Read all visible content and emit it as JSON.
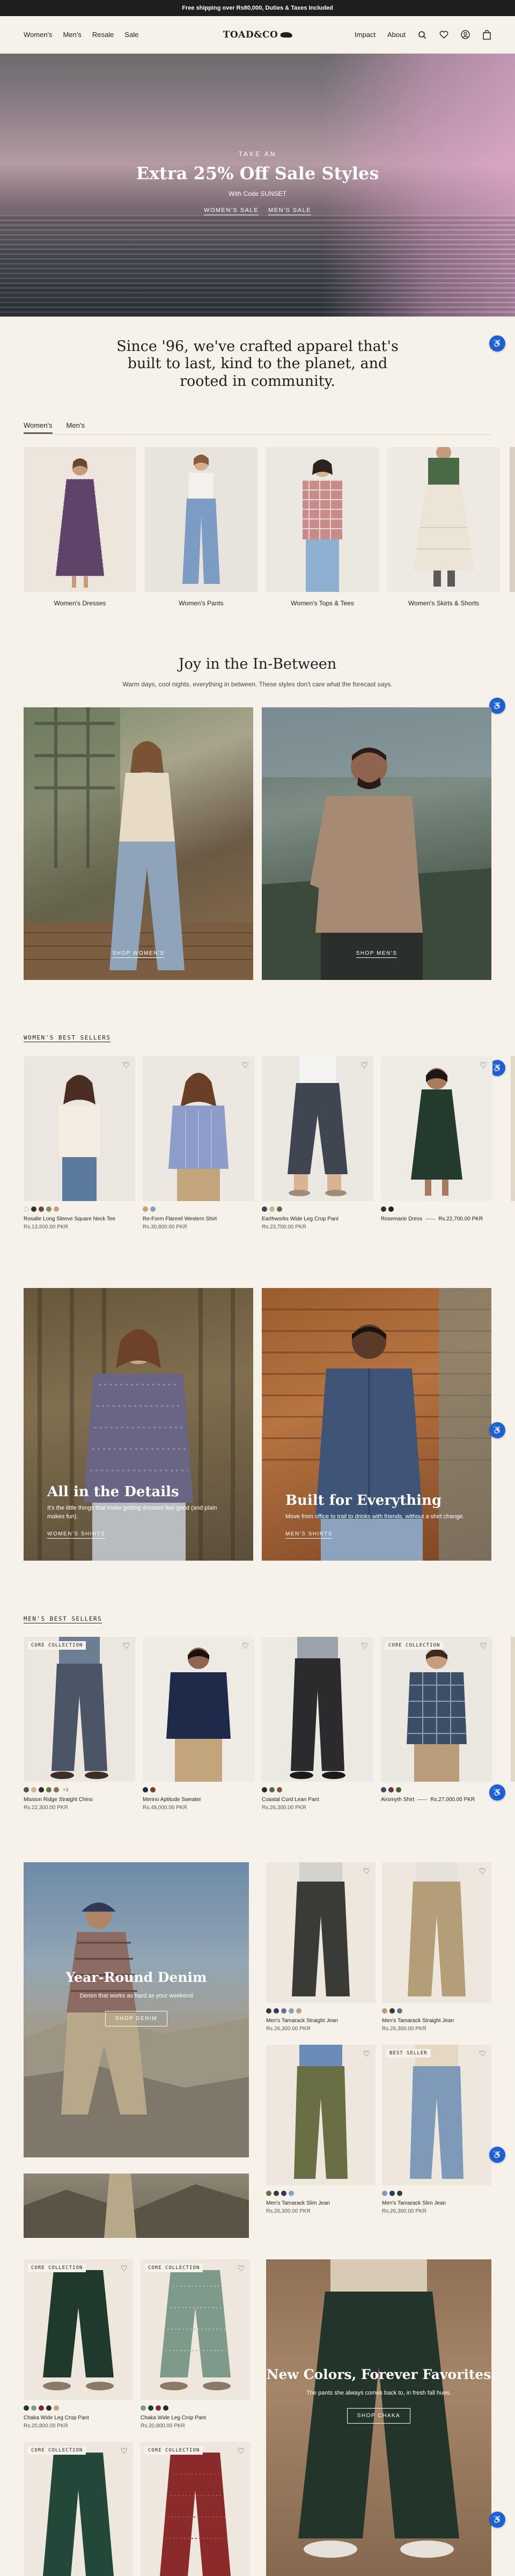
{
  "announcement": "Free shipping over Rs80,000, Duties & Taxes Included",
  "header": {
    "nav_left": [
      "Women's",
      "Men's",
      "Resale",
      "Sale"
    ],
    "logo": "TOAD&CO",
    "nav_right": [
      "Impact",
      "About"
    ],
    "icons": [
      "search-icon",
      "heart-icon",
      "account-icon",
      "bag-icon"
    ]
  },
  "hero": {
    "kicker": "TAKE AN",
    "title": "Extra 25% Off Sale Styles",
    "code": "With Code SUNSET",
    "links": [
      "WOMEN'S SALE",
      "MEN'S SALE"
    ]
  },
  "mission": "Since '96, we've crafted apparel that's built to last, kind to the planet, and rooted in community.",
  "category_tabs": [
    "Women's",
    "Men's"
  ],
  "categories": [
    "Women's Dresses",
    "Women's Pants",
    "Women's Tops & Tees",
    "Women's Skirts & Shorts"
  ],
  "joy": {
    "title": "Joy in the In-Between",
    "subtitle": "Warm days, cool nights, everything in between. These styles don't care what the forecast says.",
    "cta_left": "SHOP WOMEN'S",
    "cta_right": "SHOP MEN'S"
  },
  "womens_best": {
    "label": "WOMEN'S BEST SELLERS",
    "products": [
      {
        "name": "Rosalie Long Sleeve Square Neck Tee",
        "price": "Rs.13,500.00 PKR",
        "more": ""
      },
      {
        "name": "Re-Form Flannel Western Shirt",
        "price": "Rs.30,800.00 PKR",
        "more": ""
      },
      {
        "name": "Earthworks Wide Leg Crop Pant",
        "price": "Rs.23,700.00 PKR",
        "more": ""
      },
      {
        "name": "Rosemarie Dress",
        "price": "Rs.22,700.00 PKR",
        "more": ""
      }
    ]
  },
  "features": {
    "left": {
      "title": "All in the Details",
      "desc": "It's the little things that make getting dressed feel good (and plain makes fun).",
      "cta": "WOMEN'S SHIRTS"
    },
    "right": {
      "title": "Built for Everything",
      "desc": "Move from office to trail to drinks with friends, without a shirt change.",
      "cta": "MEN'S SHIRTS"
    }
  },
  "mens_best": {
    "label": "MEN'S BEST SELLERS",
    "badge": "CORE COLLECTION",
    "products": [
      {
        "name": "Mission Ridge Straight Chino",
        "price": "Rs.22,300.00 PKR",
        "more": "+3"
      },
      {
        "name": "Merino Aptitude Sweater",
        "price": "Rs.49,000.00 PKR",
        "more": ""
      },
      {
        "name": "Coastal Cord Lean Pant",
        "price": "Rs.26,300.00 PKR",
        "more": ""
      },
      {
        "name": "Airsmyth Shirt",
        "price": "Rs.27,000.00 PKR",
        "more": ""
      }
    ]
  },
  "denim": {
    "title": "Year-Round Denim",
    "desc": "Denim that works as hard as your weekend",
    "cta": "SHOP DENIM",
    "products": [
      {
        "name": "Men's Tamarack Straight Jean",
        "price": "Rs.26,300.00 PKR"
      },
      {
        "name": "Men's Tamarack Straight Jean",
        "price": "Rs.26,300.00 PKR"
      },
      {
        "name": "Men's Tamarack Slim Jean",
        "price": "Rs.26,300.00 PKR"
      },
      {
        "name": "Men's Tamarack Slim Jean",
        "price": "Rs.26,300.00 PKR"
      }
    ],
    "badge": "BEST SELLER"
  },
  "core_products": {
    "badge": "CORE COLLECTION",
    "items": [
      {
        "name": "Chaka Wide Leg Crop Pant",
        "price": "Rs.20,800.00 PKR"
      },
      {
        "name": "Chaka Wide Leg Crop Pant",
        "price": "Rs.20,800.00 PKR"
      }
    ]
  },
  "new_colors": {
    "title": "New Colors, Forever Favorites",
    "desc": "The pants she always comes back to, in fresh fall hues.",
    "cta": "SHOP CHAKA"
  },
  "colors": {
    "dark": "#1f1f1f",
    "cream": "#f6f2ea",
    "access": "#1b62d6"
  }
}
